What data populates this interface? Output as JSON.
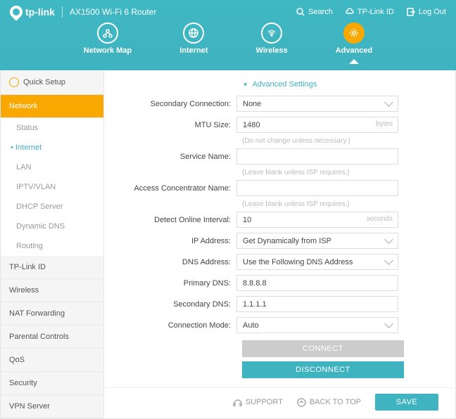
{
  "header": {
    "brand": "tp-link",
    "model": "AX1500 Wi-Fi 6 Router",
    "actions": {
      "search": "Search",
      "tplink_id": "TP-Link ID",
      "logout": "Log Out"
    },
    "nav": {
      "network_map": "Network Map",
      "internet": "Internet",
      "wireless": "Wireless",
      "advanced": "Advanced"
    }
  },
  "sidebar": {
    "quick_setup": "Quick Setup",
    "network": "Network",
    "network_sub": {
      "status": "Status",
      "internet": "Internet",
      "lan": "LAN",
      "iptv": "IPTV/VLAN",
      "dhcp": "DHCP Server",
      "ddns": "Dynamic DNS",
      "routing": "Routing"
    },
    "tplink_id": "TP-Link ID",
    "wireless": "Wireless",
    "nat": "NAT Forwarding",
    "parental": "Parental Controls",
    "qos": "QoS",
    "security": "Security",
    "vpn": "VPN Server"
  },
  "form": {
    "title": "Advanced Settings",
    "secondary_conn": {
      "label": "Secondary Connection:",
      "value": "None"
    },
    "mtu": {
      "label": "MTU Size:",
      "value": "1480",
      "unit": "bytes",
      "hint": "(Do not change unless necessary.)"
    },
    "service": {
      "label": "Service Name:",
      "value": "",
      "hint": "(Leave blank unless ISP requires.)"
    },
    "ac_name": {
      "label": "Access Concentrator Name:",
      "value": "",
      "hint": "(Leave blank unless ISP requires.)"
    },
    "detect": {
      "label": "Detect Online Interval:",
      "value": "10",
      "unit": "seconds"
    },
    "ip_addr": {
      "label": "IP Address:",
      "value": "Get Dynamically from ISP"
    },
    "dns_addr": {
      "label": "DNS Address:",
      "value": "Use the Following DNS Address"
    },
    "primary_dns": {
      "label": "Primary DNS:",
      "value": "8.8.8.8"
    },
    "secondary_dns": {
      "label": "Secondary DNS:",
      "value": "1.1.1.1"
    },
    "conn_mode": {
      "label": "Connection Mode:",
      "value": "Auto"
    },
    "connect": "CONNECT",
    "disconnect": "DISCONNECT"
  },
  "footer": {
    "support": "SUPPORT",
    "back_to_top": "BACK TO TOP",
    "save": "SAVE"
  }
}
